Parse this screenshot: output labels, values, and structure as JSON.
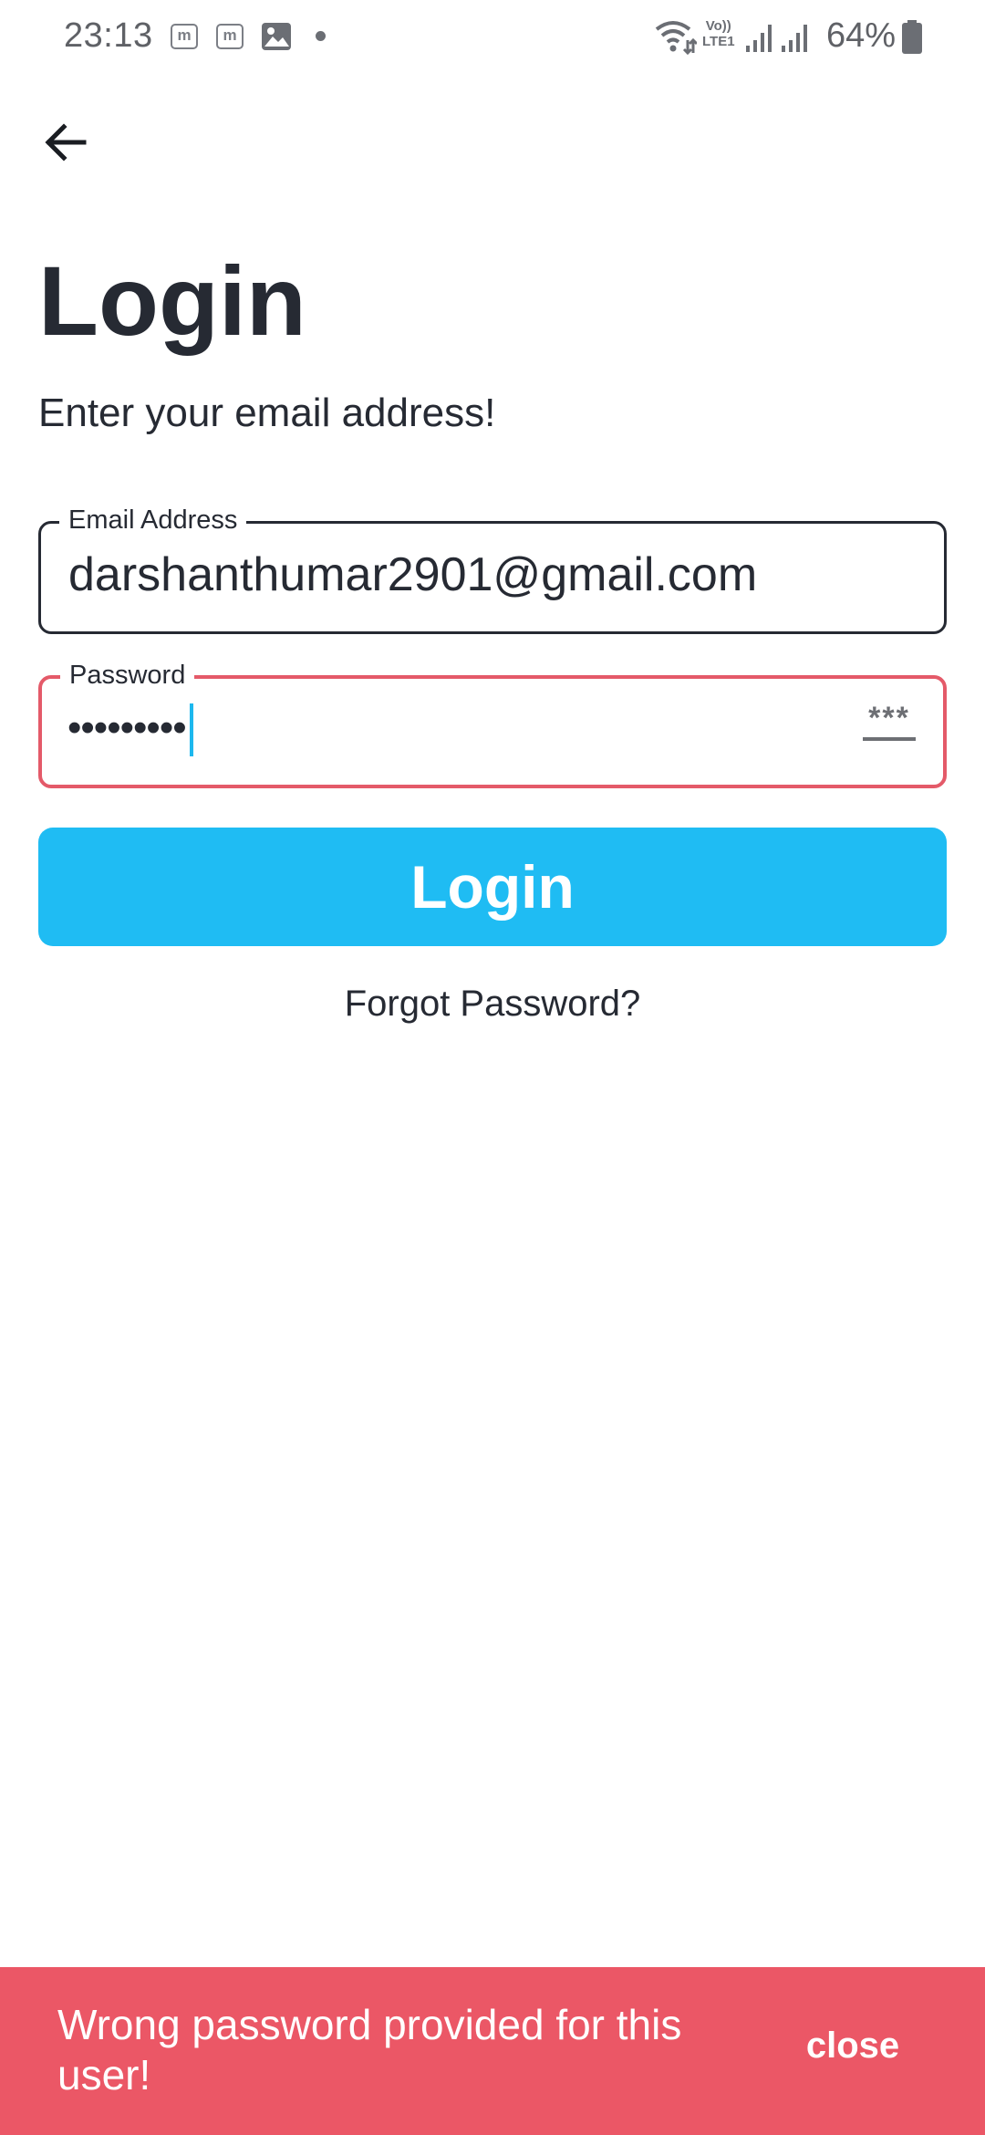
{
  "status_bar": {
    "time": "23:13",
    "notification_icons": [
      "m-app-icon",
      "m-app-icon",
      "gallery-icon",
      "dot-icon"
    ],
    "notif_m_letter": "m",
    "volte_line1": "Vo))",
    "volte_line2": "LTE1",
    "battery_percent": "64%",
    "battery_level": 0.64
  },
  "header": {
    "back_icon": "arrow-left-icon"
  },
  "main": {
    "title": "Login",
    "subtitle": "Enter your email address!",
    "email": {
      "label": "Email Address",
      "value": "darshanthumar2901@gmail.com"
    },
    "password": {
      "label": "Password",
      "masked_value": "•••••••••",
      "toggle_icon": "visibility-toggle-icon",
      "toggle_glyph": "***",
      "state": "error"
    },
    "login_button": "Login",
    "forgot_password": "Forgot Password?"
  },
  "snackbar": {
    "message": "Wrong password provided for this user!",
    "action": "close"
  },
  "colors": {
    "primary": "#1fbcf3",
    "error": "#eb5766",
    "error_border": "#e45a69",
    "text": "#262a33",
    "cursor": "#1db8ee"
  }
}
